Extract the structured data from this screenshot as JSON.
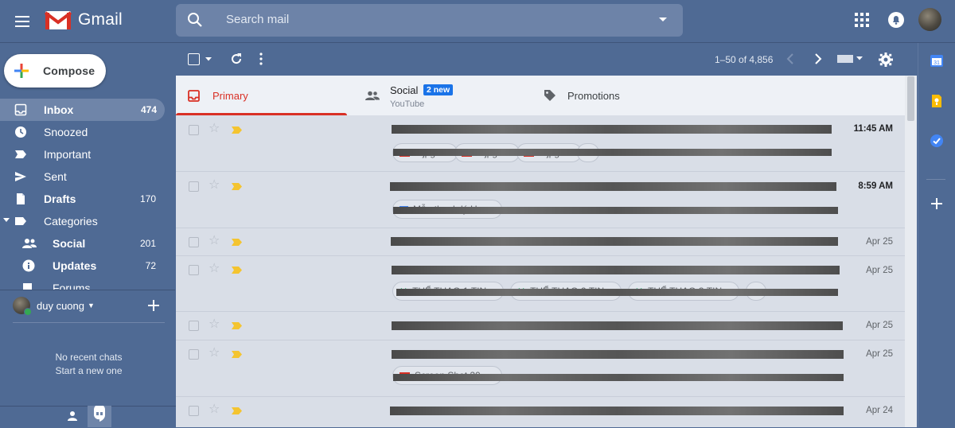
{
  "app": {
    "name": "Gmail"
  },
  "search": {
    "placeholder": "Search mail"
  },
  "compose": {
    "label": "Compose"
  },
  "nav": {
    "items": [
      {
        "label": "Inbox",
        "count": "474"
      },
      {
        "label": "Snoozed",
        "count": ""
      },
      {
        "label": "Important",
        "count": ""
      },
      {
        "label": "Sent",
        "count": ""
      },
      {
        "label": "Drafts",
        "count": "170"
      },
      {
        "label": "Categories",
        "count": ""
      },
      {
        "label": "Social",
        "count": "201"
      },
      {
        "label": "Updates",
        "count": "72"
      },
      {
        "label": "Forums",
        "count": ""
      }
    ]
  },
  "chat": {
    "user_name": "duy cuong",
    "empty_title": "No recent chats",
    "empty_action": "Start a new one"
  },
  "toolbar": {
    "pagination": "1–50 of 4,856"
  },
  "tabs": {
    "primary": {
      "label": "Primary"
    },
    "social": {
      "label": "Social",
      "badge": "2 new",
      "sublabel": "YouTube"
    },
    "promotions": {
      "label": "Promotions"
    }
  },
  "emails": [
    {
      "date": "11:45 AM"
    },
    {
      "date": "8:59 AM"
    },
    {
      "date": "Apr 25"
    },
    {
      "date": "Apr 25"
    },
    {
      "date": "Apr 25"
    },
    {
      "date": "Apr 25"
    },
    {
      "date": "Apr 24"
    }
  ],
  "attachments": {
    "row1": [
      "1.jpg",
      "2.jpg",
      "3.jpg",
      "3"
    ],
    "row2": [
      "Mẫu thanh lý Ho"
    ],
    "row4": [
      "THỂ THAO 1.TIN",
      "THỂ THAO 2.TIN",
      "THỂ THAO 3.TIN",
      ""
    ],
    "row6": [
      "Screen Shot 20"
    ]
  },
  "colors": {
    "background": "#4f6a94",
    "accent_red": "#d93025",
    "badge_blue": "#1a73e8",
    "importance_yellow": "#f4c430"
  }
}
